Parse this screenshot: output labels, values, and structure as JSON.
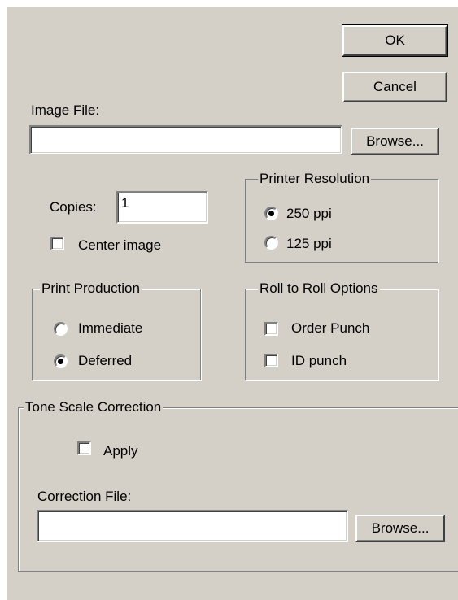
{
  "buttons": {
    "ok": "OK",
    "cancel": "Cancel"
  },
  "image_file": {
    "label": "Image File:",
    "value": "",
    "browse": "Browse..."
  },
  "copies": {
    "label": "Copies:",
    "value": "1"
  },
  "center_image": {
    "label": "Center image",
    "checked": false
  },
  "printer_resolution": {
    "title": "Printer Resolution",
    "options": [
      {
        "label": "250 ppi",
        "selected": true
      },
      {
        "label": "125 ppi",
        "selected": false
      }
    ]
  },
  "print_production": {
    "title": "Print Production",
    "options": [
      {
        "label": "Immediate",
        "selected": false
      },
      {
        "label": "Deferred",
        "selected": true
      }
    ]
  },
  "roll_to_roll": {
    "title": "Roll to Roll Options",
    "options": [
      {
        "label": "Order Punch",
        "checked": false
      },
      {
        "label": "ID punch",
        "checked": false
      }
    ]
  },
  "tone_scale": {
    "title": "Tone Scale Correction",
    "apply_label": "Apply",
    "apply_checked": false,
    "correction_file_label": "Correction File:",
    "correction_file_value": "",
    "browse": "Browse..."
  },
  "colors": {
    "face": "#d4d0c8",
    "shadow": "#808080",
    "highlight": "#ffffff",
    "field": "#ffffff"
  }
}
